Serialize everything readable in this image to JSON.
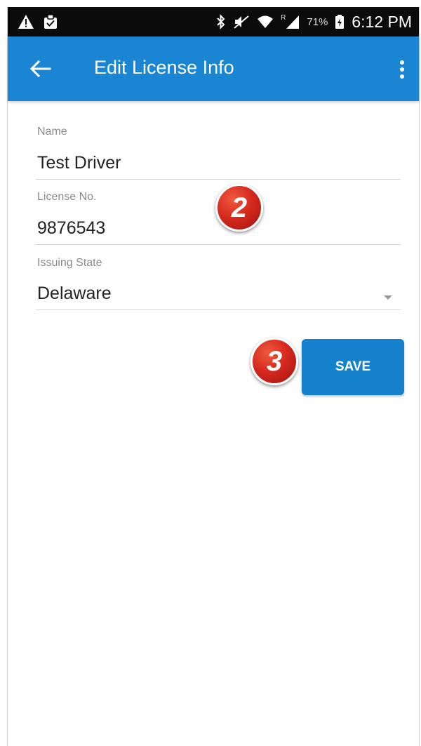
{
  "status_bar": {
    "left_icons": [
      "warning-icon",
      "clipboard-icon"
    ],
    "right_icons": [
      "bluetooth-icon",
      "mute-icon",
      "wifi-icon",
      "signal-icon",
      "battery-charging-icon"
    ],
    "roaming": "R",
    "battery": "71%",
    "time": "6:12 PM"
  },
  "app_bar": {
    "title": "Edit License Info",
    "back_icon": "arrow-left-icon",
    "menu_icon": "more-vert-icon",
    "color": "#1a86d3"
  },
  "form": {
    "name": {
      "label": "Name",
      "value": "Test Driver"
    },
    "license": {
      "label": "License No.",
      "value": "9876543"
    },
    "state": {
      "label": "Issuing State",
      "value": "Delaware"
    }
  },
  "save_button": {
    "label": "SAVE",
    "color": "#1580cc"
  },
  "step_badges": {
    "license_step": "2",
    "save_step": "3",
    "color": "#d62a1e"
  }
}
